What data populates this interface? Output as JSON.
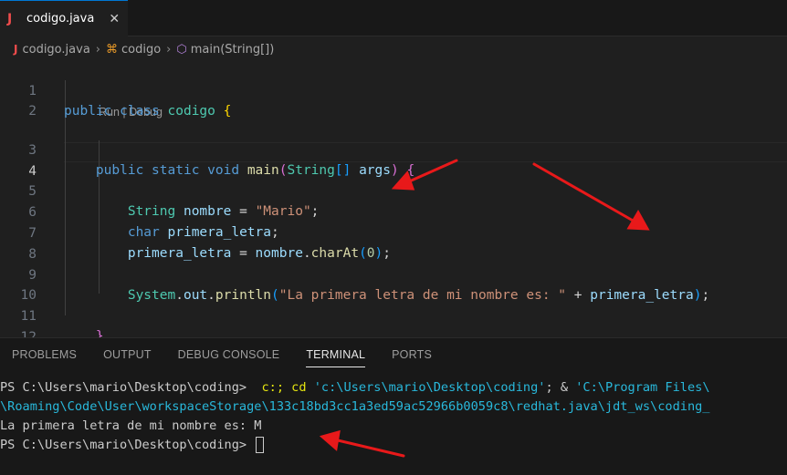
{
  "tab": {
    "icon": "java-file-icon",
    "icon_text": "J",
    "name": "codigo.java",
    "close": "✕"
  },
  "breadcrumb": {
    "file": "codigo.java",
    "class": "codigo",
    "method": "main(String[])"
  },
  "codelens": "Run | Debug",
  "editor": {
    "line_numbers": [
      "1",
      "2",
      "3",
      "4",
      "5",
      "6",
      "7",
      "8",
      "9",
      "10",
      "11",
      "12"
    ],
    "active_line": "4"
  },
  "panel": {
    "tabs": [
      "PROBLEMS",
      "OUTPUT",
      "DEBUG CONSOLE",
      "TERMINAL",
      "PORTS"
    ],
    "selected_tab": "TERMINAL"
  },
  "terminal": {
    "line1_prompt": "PS C:\\Users\\mario\\Desktop\\coding> ",
    "line1_cmd": " c:; cd ",
    "line1_path": "'c:\\Users\\mario\\Desktop\\coding'",
    "line1_rest": "; & ",
    "line1_path2": "'C:\\Program Files\\",
    "line2": "\\Roaming\\Code\\User\\workspaceStorage\\133c18bd3cc1a3ed59ac52966b0059c8\\redhat.java\\jdt_ws\\coding_",
    "line3": "La primera letra de mi nombre es: M",
    "line4_prompt": "PS C:\\Users\\mario\\Desktop\\coding> "
  },
  "colors": {
    "accent": "#0078d4",
    "arrow": "#e8191a"
  }
}
